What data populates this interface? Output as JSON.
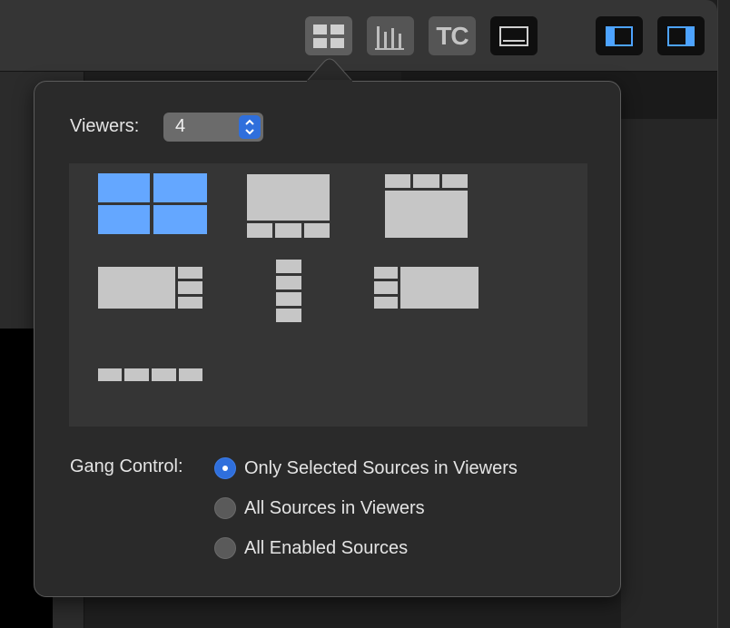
{
  "toolbar": {
    "buttons": [
      {
        "name": "viewer-layout-icon",
        "active": true
      },
      {
        "name": "audio-meters-icon"
      },
      {
        "name": "timecode-button",
        "label": "TC"
      },
      {
        "name": "monitor-icon"
      },
      {
        "name": "left-sidebar-icon"
      },
      {
        "name": "right-sidebar-icon"
      }
    ]
  },
  "popover": {
    "viewers_label": "Viewers:",
    "viewers_value": "4",
    "layouts": [
      {
        "name": "grid-2x2",
        "selected": true
      },
      {
        "name": "large-top-three-bottom"
      },
      {
        "name": "three-top-large-bottom"
      },
      {
        "name": "large-left-three-right"
      },
      {
        "name": "four-stacked-vertical"
      },
      {
        "name": "three-left-large-right"
      },
      {
        "name": "four-in-row"
      }
    ],
    "gang_label": "Gang Control:",
    "gang_options": [
      {
        "label": "Only Selected Sources in Viewers",
        "checked": true
      },
      {
        "label": "All Sources in Viewers",
        "checked": false
      },
      {
        "label": "All Enabled Sources",
        "checked": false
      }
    ]
  },
  "colors": {
    "accent": "#2f6fdc",
    "selected_layout": "#64a7ff",
    "layout_cell": "#c6c6c6"
  }
}
